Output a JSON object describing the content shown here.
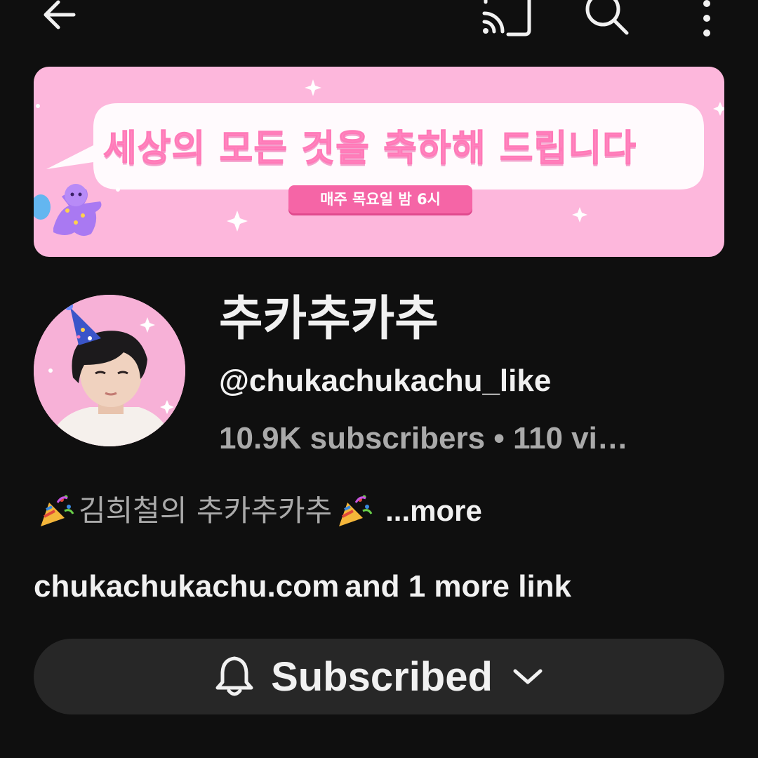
{
  "toolbar": {
    "icons": [
      "back-arrow-icon",
      "cast-icon",
      "search-icon",
      "more-vert-icon"
    ]
  },
  "banner": {
    "title": "세상의 모든 것을 축하해 드립니다",
    "schedule": "매주 목요일 밤 6시",
    "background_color": "#fdb7dc"
  },
  "channel": {
    "name": "추카추카추",
    "handle": "@chukachukachu_like",
    "stats": "10.9K subscribers • 110 vi…",
    "description": "김희철의 추카추카추",
    "description_more": "...more",
    "link": "chukachukachu.com",
    "link_more": "and 1 more link"
  },
  "subscribe": {
    "label": "Subscribed",
    "icon": "bell-icon",
    "dropdown_icon": "chevron-down-icon",
    "button_color": "#272727"
  }
}
